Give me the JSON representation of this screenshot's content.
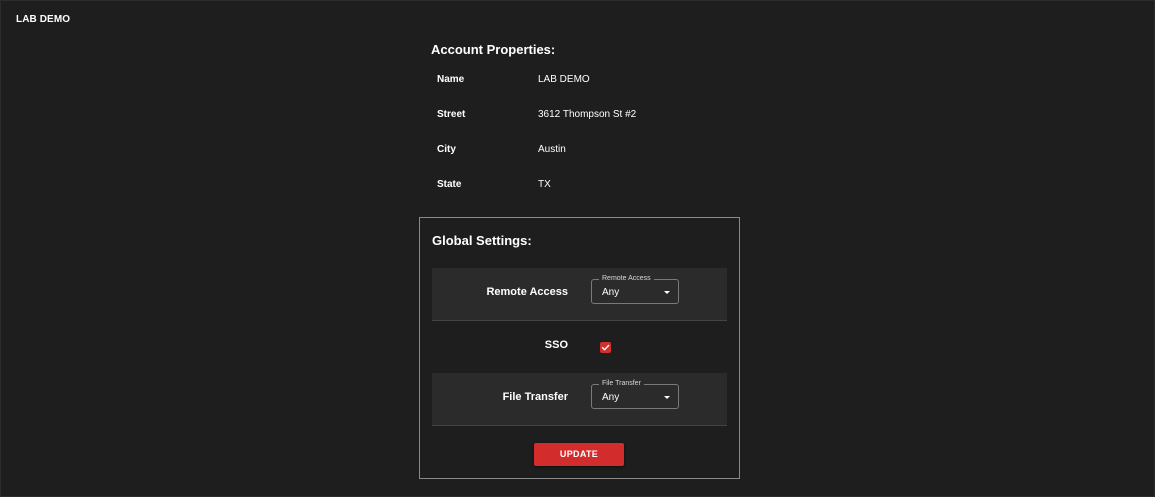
{
  "header": {
    "org_name": "LAB DEMO"
  },
  "account": {
    "title": "Account Properties:",
    "properties": [
      {
        "key": "Name",
        "value": "LAB DEMO"
      },
      {
        "key": "Street",
        "value": "3612 Thompson St #2"
      },
      {
        "key": "City",
        "value": "Austin"
      },
      {
        "key": "State",
        "value": "TX"
      }
    ]
  },
  "global_settings": {
    "title": "Global Settings:",
    "remote_access": {
      "label": "Remote Access",
      "field_label": "Remote Access",
      "value": "Any"
    },
    "sso": {
      "label": "SSO",
      "checked": true
    },
    "file_transfer": {
      "label": "File Transfer",
      "field_label": "File Transfer",
      "value": "Any"
    },
    "update_label": "UPDATE"
  },
  "colors": {
    "background": "#1e1e1e",
    "accent": "#d22c2c",
    "shaded_row": "#2b2b2b"
  }
}
